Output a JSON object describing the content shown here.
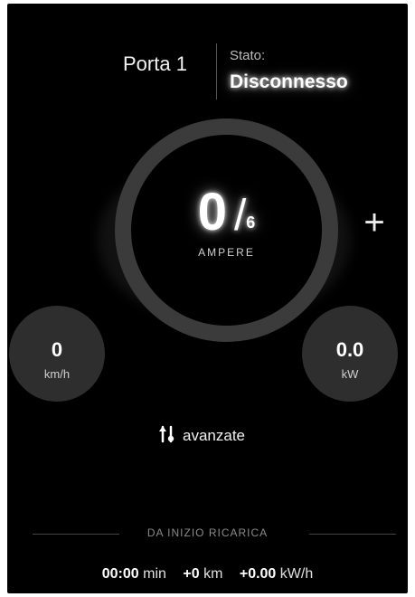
{
  "header": {
    "port_name": "Porta 1",
    "status_label": "Stato:",
    "status_value": "Disconnesso"
  },
  "gauge": {
    "current_value": "0",
    "max_value": "6",
    "slash": "/",
    "unit": "AMPERE",
    "increase_symbol": "+"
  },
  "stats": {
    "speed_value": "0",
    "speed_unit": "km/h",
    "power_value": "0.0",
    "power_unit": "kW"
  },
  "advanced": {
    "label": "avanzate",
    "icon": "tool-icon"
  },
  "summary": {
    "section_title": "DA INIZIO RICARICA",
    "time_value": "00:00",
    "time_unit": "min",
    "distance_value": "+0",
    "distance_unit": "km",
    "energy_value": "+0.00",
    "energy_unit": "kW/h"
  }
}
